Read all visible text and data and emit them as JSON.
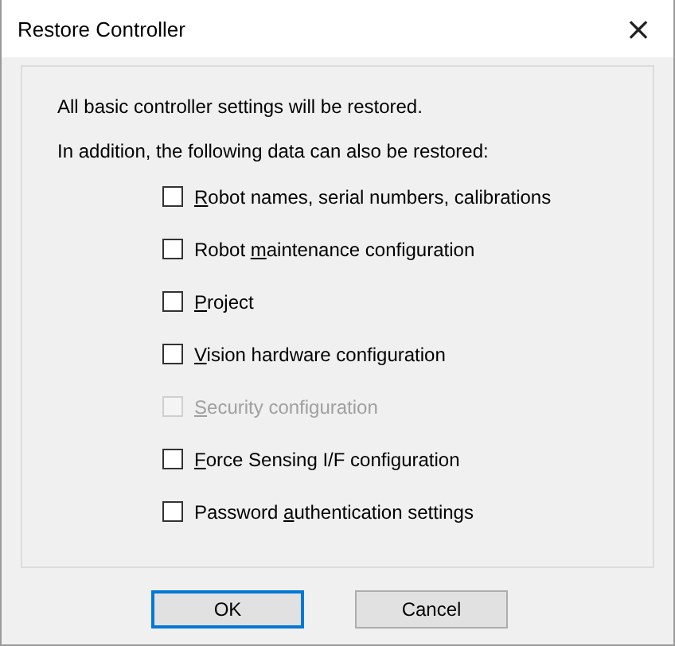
{
  "window": {
    "title": "Restore Controller",
    "close": "×"
  },
  "intro": [
    "All basic controller settings will be restored.",
    "In addition, the following data can also be restored:"
  ],
  "options": [
    {
      "key": "R",
      "post": "obot names, serial numbers, calibrations",
      "checked": false,
      "disabled": false
    },
    {
      "pre": "Robot ",
      "key": "m",
      "post": "aintenance configuration",
      "checked": false,
      "disabled": false
    },
    {
      "key": "P",
      "post": "roject",
      "checked": false,
      "disabled": false
    },
    {
      "key": "V",
      "post": "ision hardware configuration",
      "checked": false,
      "disabled": false
    },
    {
      "key": "S",
      "post": "ecurity configuration",
      "checked": false,
      "disabled": true
    },
    {
      "key": "F",
      "post": "orce Sensing I/F configuration",
      "checked": false,
      "disabled": false
    },
    {
      "pre": "Password ",
      "key": "a",
      "post": "uthentication settings",
      "checked": false,
      "disabled": false
    }
  ],
  "buttons": [
    {
      "label": "OK",
      "default": true
    },
    {
      "label": "Cancel",
      "default": false
    }
  ]
}
